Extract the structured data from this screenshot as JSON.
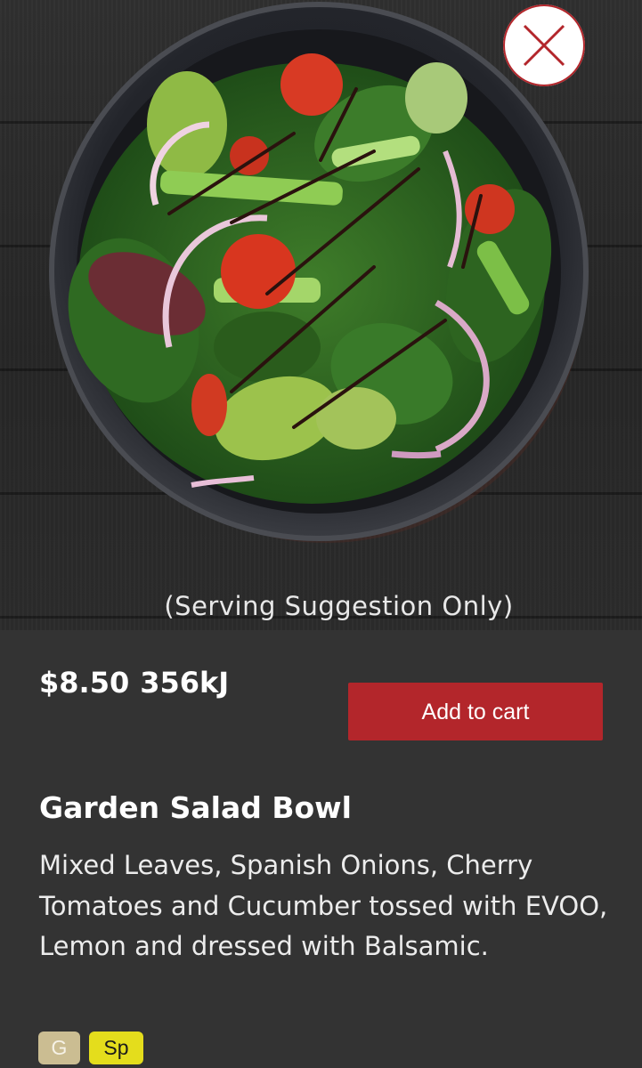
{
  "hero": {
    "caption": "(Serving Suggestion Only)"
  },
  "close_button": {
    "icon": "close-icon",
    "accent_color": "#b3262b"
  },
  "product": {
    "price": "$8.50",
    "energy": "356kJ",
    "name": "Garden Salad Bowl",
    "description": "Mixed Leaves, Spanish Onions, Cherry Tomatoes and Cucumber tossed with EVOO, Lemon and dressed with Balsamic."
  },
  "actions": {
    "add_to_cart_label": "Add to cart",
    "button_color": "#b3262b"
  },
  "dietary_tags": [
    {
      "label": "G",
      "color": "#cbbd92"
    },
    {
      "label": "Sp",
      "color": "#e4dd1c"
    }
  ]
}
